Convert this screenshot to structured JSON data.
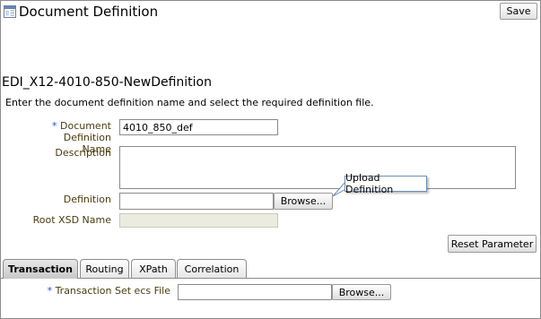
{
  "header": {
    "title": "Document Definition",
    "save_label": "Save",
    "icon": "document-definition-icon"
  },
  "document": {
    "name": "EDI_X12-4010-850-NewDefinition",
    "instructions": "Enter the document definition name and select the required definition file."
  },
  "form": {
    "required_marker": "*",
    "def_name_label_line1": "Document Definition",
    "def_name_label_line2": "Name",
    "def_name_value": "4010_850_def",
    "description_label": "Description",
    "description_value": "",
    "definition_label": "Definition",
    "definition_value": "",
    "browse_label": "Browse...",
    "root_xsd_label": "Root XSD Name",
    "root_xsd_value": "",
    "reset_label": "Reset Parameter"
  },
  "tooltip": {
    "text": "Upload Definition"
  },
  "tabs": [
    {
      "label": "Transaction",
      "active": true
    },
    {
      "label": "Routing",
      "active": false
    },
    {
      "label": "XPath",
      "active": false
    },
    {
      "label": "Correlation",
      "active": false
    }
  ],
  "transaction": {
    "label": "Transaction Set ecs File",
    "value": "",
    "browse_label": "Browse..."
  },
  "colors": {
    "label_brown": "#4a3b0f",
    "required_blue": "#1c4ed6",
    "tooltip_border": "#6b8fb3"
  }
}
